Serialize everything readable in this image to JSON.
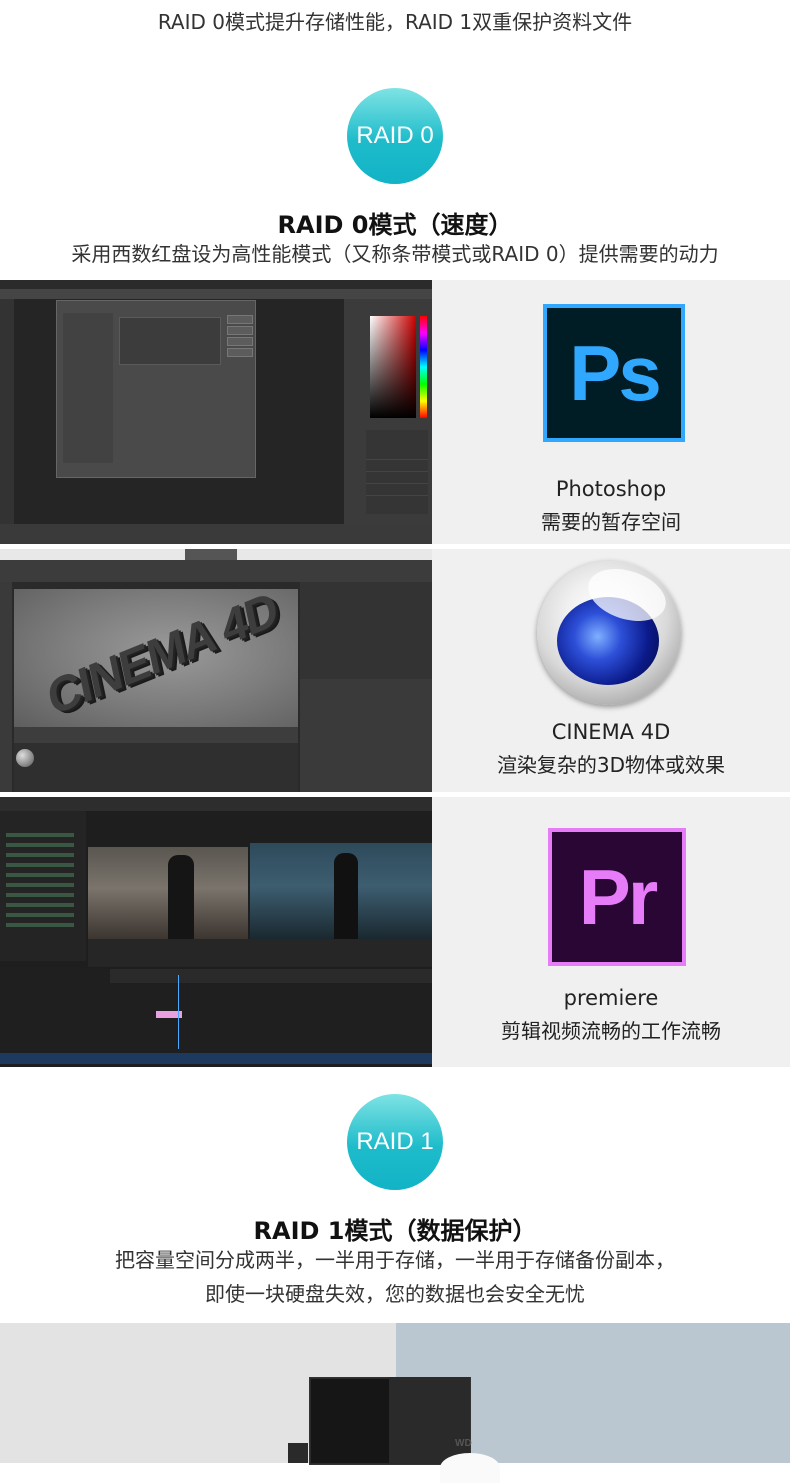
{
  "intro": "RAID 0模式提升存储性能，RAID 1双重保护资料文件",
  "raid0": {
    "badge": "RAID 0",
    "title": "RAID 0模式（速度）",
    "subtitle": "采用西数红盘设为高性能模式（又称条带模式或RAID 0）提供需要的动力"
  },
  "apps": [
    {
      "name": "Photoshop",
      "desc": "需要的暂存空间",
      "icon": "photoshop-icon",
      "icon_text": "Ps",
      "color": "#31a8ff",
      "bg": "#001d26"
    },
    {
      "name": "CINEMA 4D",
      "desc": "渲染复杂的3D物体或效果",
      "icon": "cinema4d-icon",
      "watermark": "CINEMA 4D"
    },
    {
      "name": "premiere",
      "desc": "剪辑视频流畅的工作流畅",
      "icon": "premiere-icon",
      "icon_text": "Pr",
      "color": "#e77cf9",
      "bg": "#2a0634"
    }
  ],
  "raid1": {
    "badge": "RAID 1",
    "title": "RAID 1模式（数据保护）",
    "subtitle_line1": "把容量空间分成两半，一半用于存储，一半用于存储备份副本，",
    "subtitle_line2": "即使一块硬盘失效，您的数据也会安全无忧"
  },
  "product": {
    "logo": "WD"
  },
  "colors": {
    "badge_gradient_top": "#7fe3e4",
    "badge_gradient_bottom": "#12b3c6",
    "row_bg": "#f0f0f0"
  }
}
